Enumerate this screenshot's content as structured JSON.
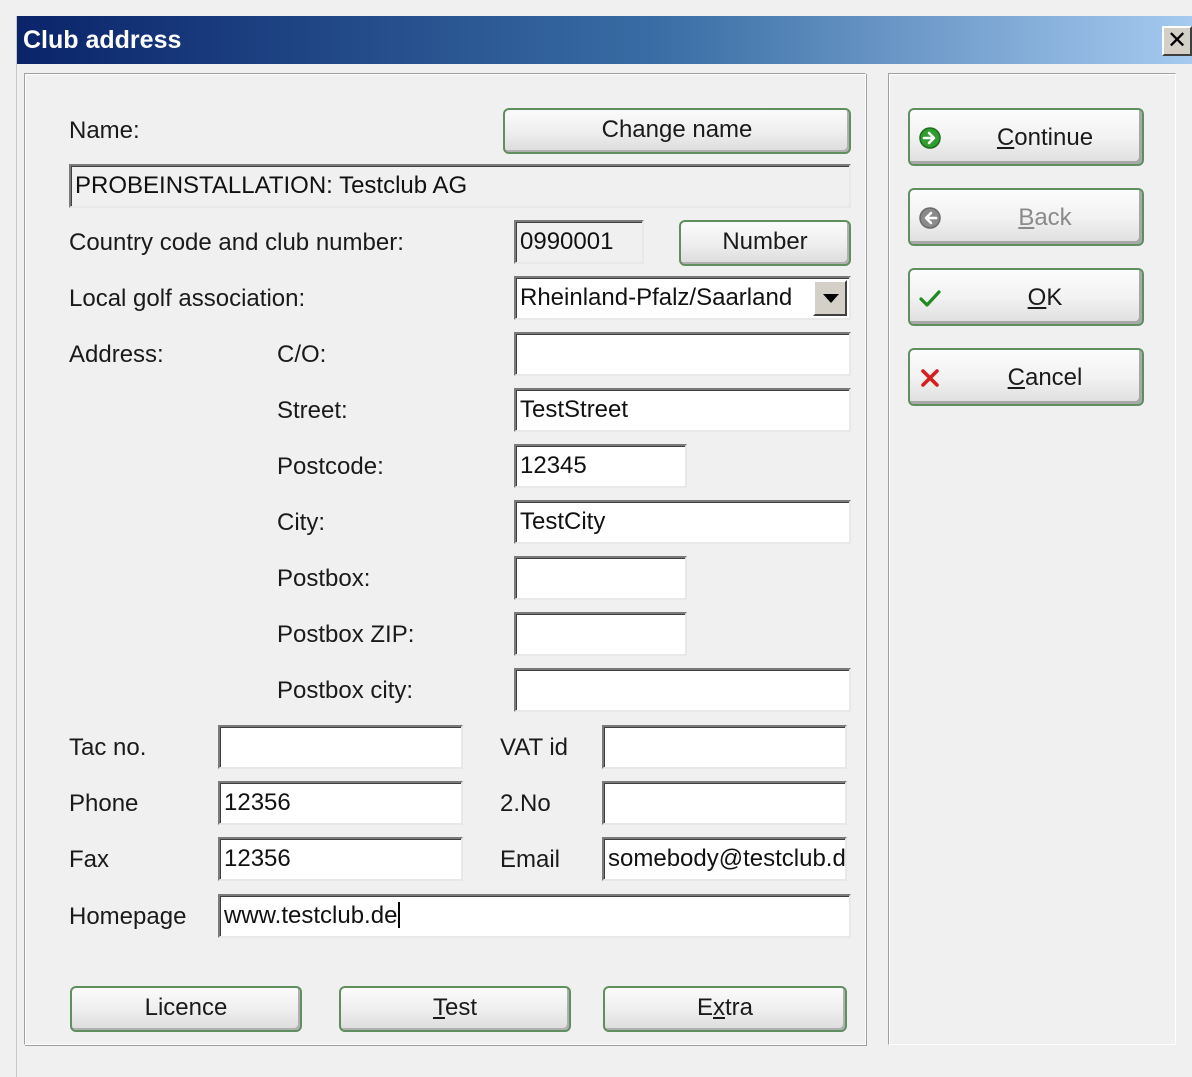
{
  "window": {
    "title": "Club address",
    "close_glyph": "✕"
  },
  "labels": {
    "name": "Name:",
    "country_code": "Country code and club number:",
    "golf_assoc": "Local golf association:",
    "address": "Address:",
    "co": "C/O:",
    "street": "Street:",
    "postcode": "Postcode:",
    "city": "City:",
    "postbox": "Postbox:",
    "postbox_zip": "Postbox ZIP:",
    "postbox_city": "Postbox city:",
    "tac": "Tac no.",
    "vat": "VAT id",
    "phone": "Phone",
    "second_no": "2.No",
    "fax": "Fax",
    "email": "Email",
    "homepage": "Homepage"
  },
  "fields": {
    "name": "PROBEINSTALLATION: Testclub AG",
    "club_number": "0990001",
    "golf_assoc": "Rheinland-Pfalz/Saarland",
    "co": "",
    "street": "TestStreet",
    "postcode": "12345",
    "city": "TestCity",
    "postbox": "",
    "postbox_zip": "",
    "postbox_city": "",
    "tac": "",
    "vat": "",
    "phone": "12356",
    "second_no": "",
    "fax": "12356",
    "email": "somebody@testclub.de",
    "homepage": "www.testclub.de"
  },
  "buttons": {
    "change_name": "Change name",
    "number": "Number",
    "licence": "Licence",
    "test_pre": "",
    "test_u": "T",
    "test_post": "est",
    "extra_pre": "E",
    "extra_u": "x",
    "extra_post": "tra"
  },
  "side_buttons": {
    "continue_u": "C",
    "continue_rest": "ontinue",
    "back_u": "B",
    "back_rest": "ack",
    "ok_u": "O",
    "ok_rest": "K",
    "cancel_u": "C",
    "cancel_rest": "ancel"
  },
  "icons": {
    "continue": "arrow-right-circle-icon",
    "back": "arrow-left-circle-icon",
    "ok": "checkmark-icon",
    "cancel": "x-mark-icon"
  },
  "colors": {
    "title_start": "#0a246a",
    "title_end": "#a6caf0",
    "button_border": "#5f8f5f"
  }
}
